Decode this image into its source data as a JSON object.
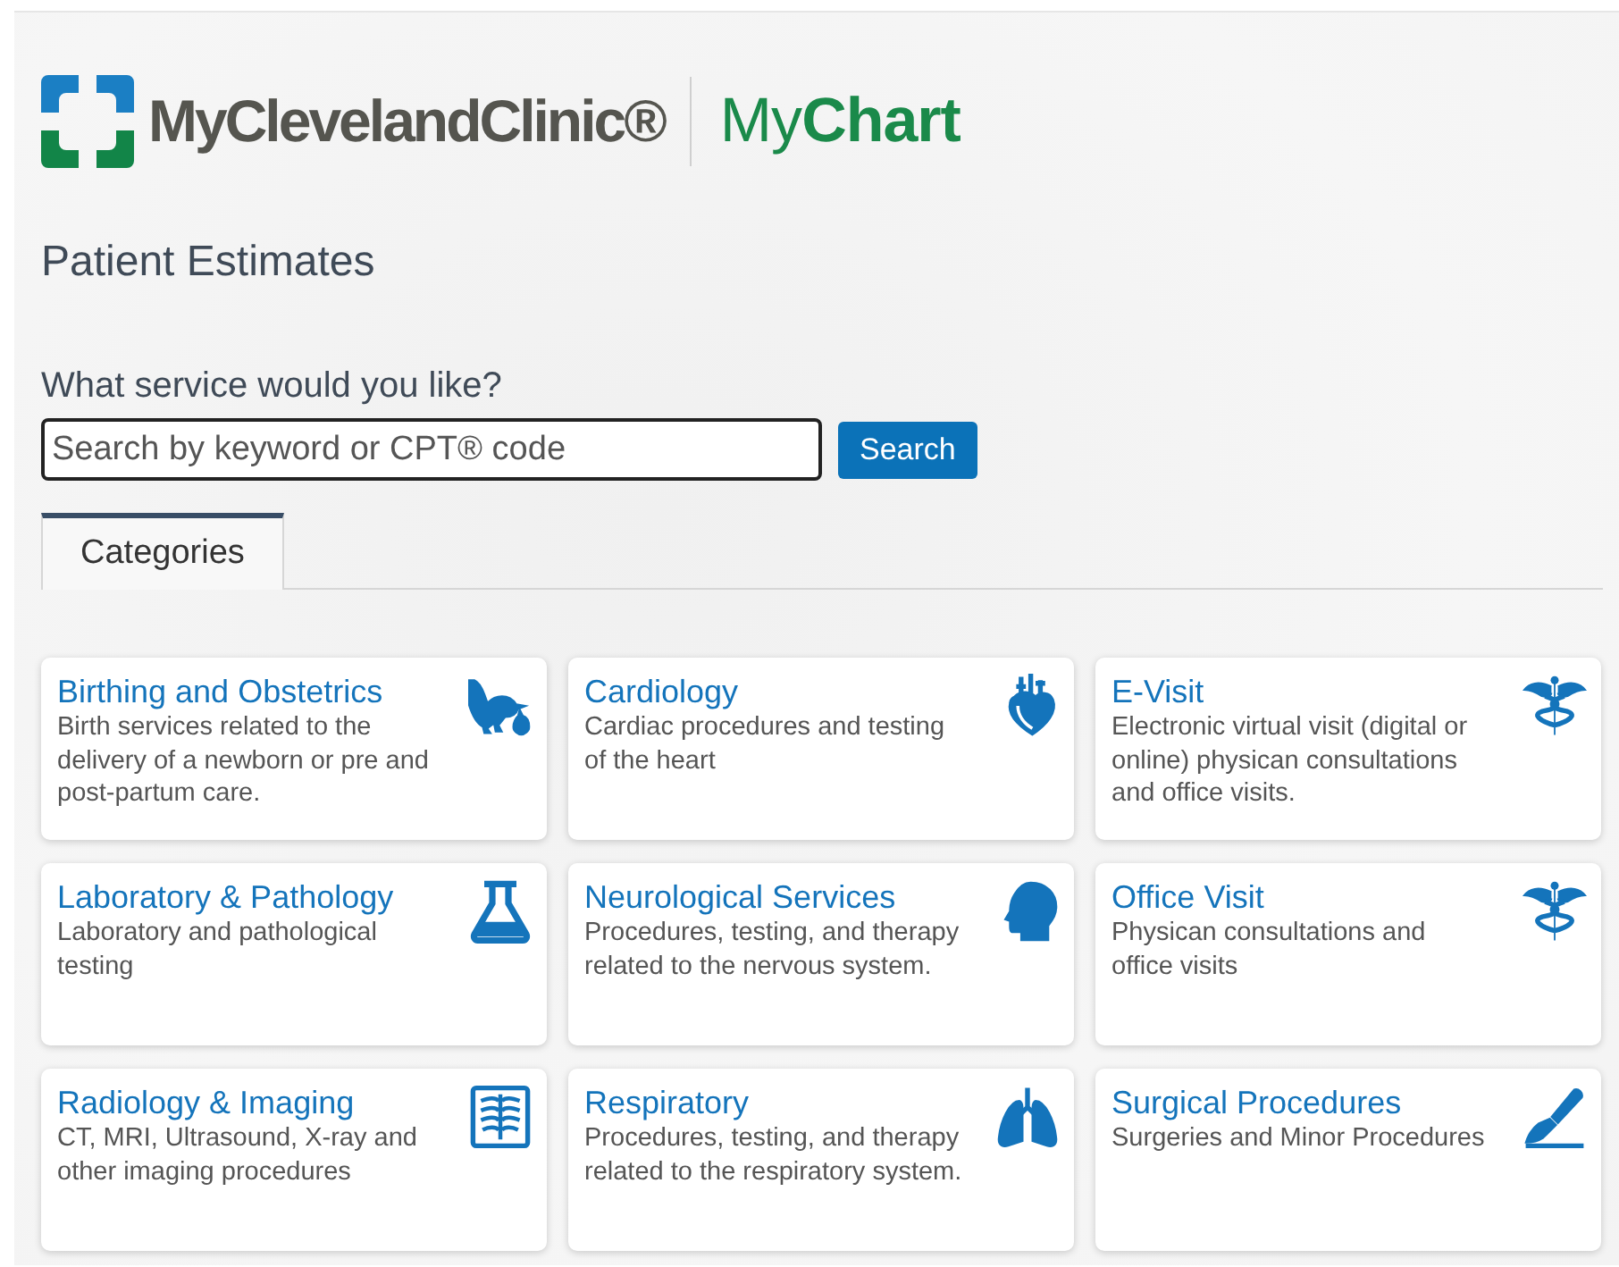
{
  "header": {
    "brand": "MyClevelandClinic®",
    "product": "My**Chart**"
  },
  "page_title": "Patient Estimates",
  "search": {
    "label": "What service would you like?",
    "placeholder": "Search by keyword or CPT® code",
    "button": "Search"
  },
  "tabs": [
    {
      "label": "Categories",
      "selected": true
    }
  ],
  "categories": [
    {
      "title": "Birthing and Obstetrics",
      "description": "Birth services related to the delivery of a newborn or pre and post-partum care."
    },
    {
      "title": "Cardiology",
      "description": "Cardiac procedures and testing of the heart"
    },
    {
      "title": "E-Visit",
      "description": "Electronic virtual visit (digital or online) physican consultations and office visits."
    },
    {
      "title": "Laboratory & Pathology",
      "description": "Laboratory and pathological testing"
    },
    {
      "title": "Neurological Services",
      "description": "Procedures, testing, and therapy related to the nervous system."
    },
    {
      "title": "Office Visit",
      "description": "Physican consultations and office visits"
    },
    {
      "title": "Radiology & Imaging",
      "description": "CT, MRI, Ultrasound, X-ray and other imaging procedures"
    },
    {
      "title": "Respiratory",
      "description": "Procedures, testing, and therapy related to the respiratory system."
    },
    {
      "title": "Surgical Procedures",
      "description": "Surgeries and Minor Procedures"
    }
  ]
}
